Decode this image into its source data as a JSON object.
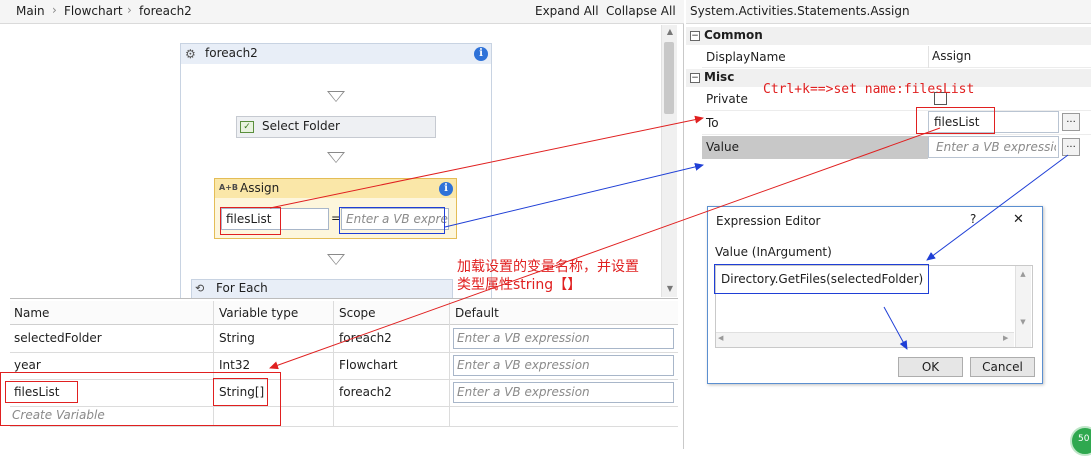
{
  "breadcrumb": [
    "Main",
    "Flowchart",
    "foreach2"
  ],
  "toolbar": {
    "expand_all": "Expand All",
    "collapse_all": "Collapse All"
  },
  "activities": {
    "foreach2": "foreach2",
    "select_folder": "Select Folder",
    "assign": "Assign",
    "assign_icon": "A+B",
    "assign_to": "filesList",
    "assign_eq": "=",
    "assign_value_placeholder": "Enter a VB expre",
    "for_each": "For Each"
  },
  "variables": {
    "headers": [
      "Name",
      "Variable type",
      "Scope",
      "Default"
    ],
    "rows": [
      {
        "name": "selectedFolder",
        "type": "String",
        "scope": "foreach2",
        "default": "Enter a VB expression"
      },
      {
        "name": "year",
        "type": "Int32",
        "scope": "Flowchart",
        "default": "Enter a VB expression"
      },
      {
        "name": "filesList",
        "type": "String[]",
        "scope": "foreach2",
        "default": "Enter a VB expression"
      }
    ],
    "create": "Create Variable"
  },
  "properties": {
    "title": "System.Activities.Statements.Assign",
    "common": "Common",
    "displayname_label": "DisplayName",
    "displayname_value": "Assign",
    "misc": "Misc",
    "private_label": "Private",
    "to_label": "To",
    "to_value": "filesList",
    "value_label": "Value",
    "value_placeholder": "Enter a VB expressio",
    "dots": "..."
  },
  "expression_editor": {
    "title": "Expression Editor",
    "help": "?",
    "close": "✕",
    "label": "Value (InArgument)",
    "expression": "Directory.GetFiles(selectedFolder)",
    "ok": "OK",
    "cancel": "Cancel"
  },
  "annotations": {
    "shortcut": "Ctrl+k==>set name:filesList",
    "note_line1": "加载设置的变量名称，并设置",
    "note_line2": "类型属性string【】"
  },
  "badge": "50",
  "colors": {
    "annotation_red": "#e02020",
    "annotation_blue": "#1f3fd6",
    "assign_accent": "#e4bd56",
    "info_blue": "#2f72d8"
  }
}
